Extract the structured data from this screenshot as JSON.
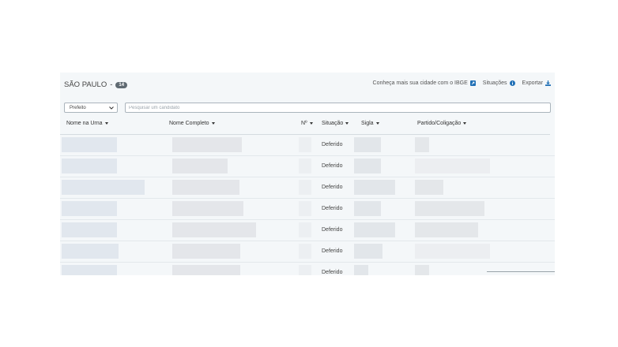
{
  "header": {
    "city": "SÃO PAULO",
    "separator": "-",
    "count": "14"
  },
  "links": {
    "city_info": "Conheça mais sua cidade com o IBGE",
    "situations": "Situações",
    "export": "Exportar"
  },
  "filters": {
    "position_selected": "Prefeito",
    "search_placeholder": "Pesquisar um candidato"
  },
  "table": {
    "columns": [
      "Nome na Urna",
      "Nome Completo",
      "Nº",
      "Situação",
      "Sigla",
      "Partido/Coligação"
    ],
    "rows": [
      {
        "situacao": "Deferido"
      },
      {
        "situacao": "Deferido"
      },
      {
        "situacao": "Deferido"
      },
      {
        "situacao": "Deferido"
      },
      {
        "situacao": "Deferido"
      },
      {
        "situacao": "Deferido"
      },
      {
        "situacao": "Deferido"
      }
    ]
  },
  "colors": {
    "accent": "#1f6fb5",
    "badge": "#5f6a72",
    "panel_bg": "#f4f7f9"
  },
  "icons": {
    "city_info": "external-link-icon",
    "situations": "info-circle-icon",
    "export": "download-icon"
  }
}
